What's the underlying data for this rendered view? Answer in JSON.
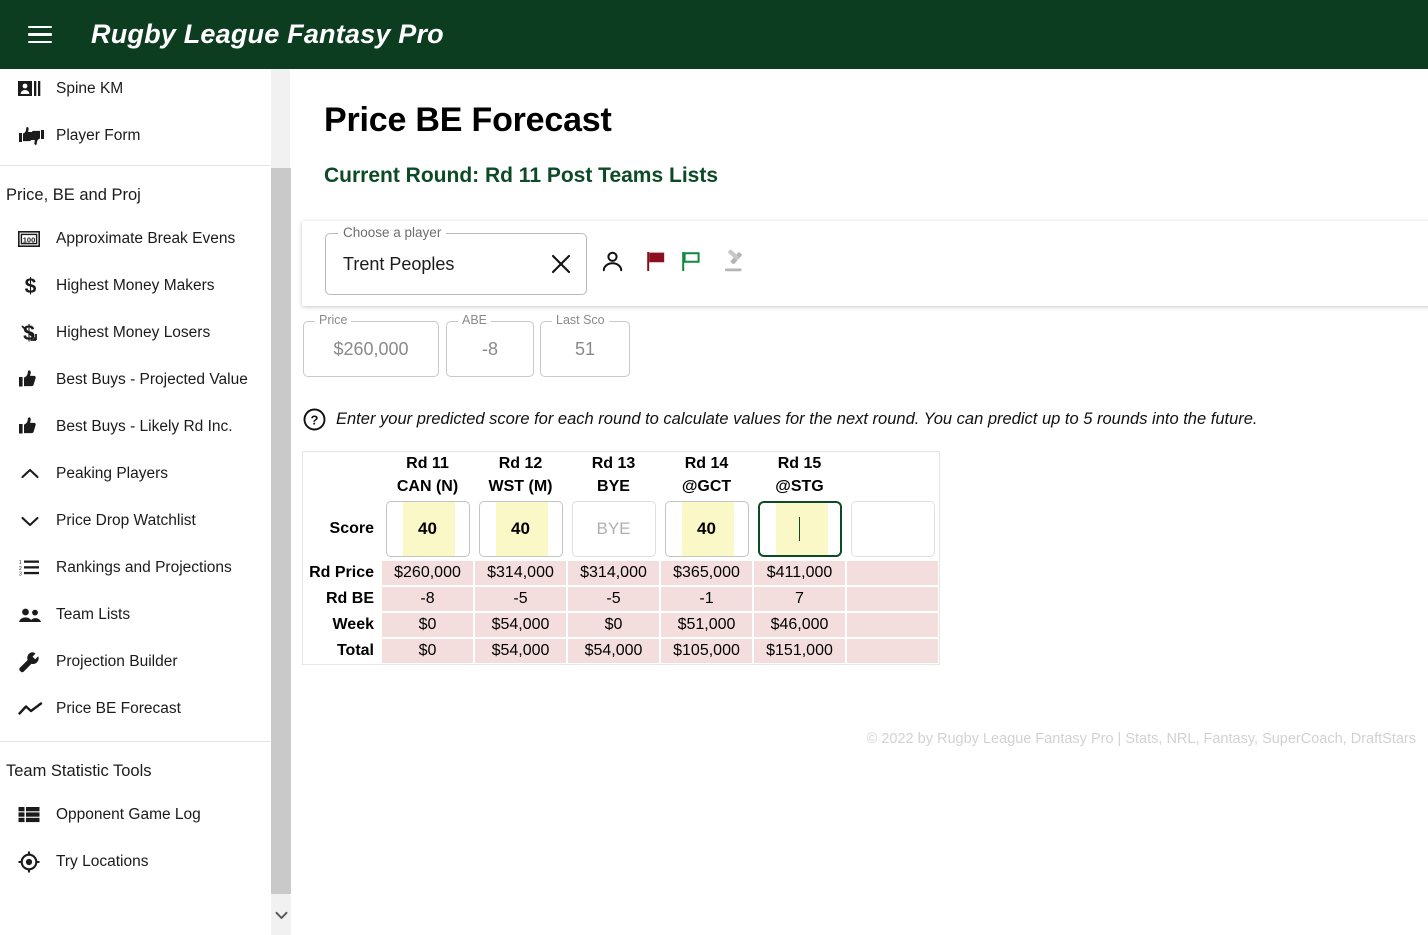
{
  "header": {
    "title": "Rugby League Fantasy Pro",
    "menu_icon": "hamburger-menu-icon",
    "background_color": "#0d3d21"
  },
  "sidebar": {
    "top_items": [
      {
        "label": "Spine KM",
        "icon": "spine-km-icon"
      },
      {
        "label": "Player Form",
        "icon": "thumbs-up-down-icon"
      }
    ],
    "sections": [
      {
        "title": "Price, BE and Proj",
        "items": [
          {
            "label": "Approximate Break Evens",
            "icon": "money-100-icon"
          },
          {
            "label": "Highest Money Makers",
            "icon": "dollar-sign-icon"
          },
          {
            "label": "Highest Money Losers",
            "icon": "dollar-down-icon"
          },
          {
            "label": "Best Buys - Projected Value",
            "icon": "thumbs-up-icon"
          },
          {
            "label": "Best Buys - Likely Rd Inc.",
            "icon": "thumbs-up-icon"
          },
          {
            "label": "Peaking Players",
            "icon": "chevron-up-icon"
          },
          {
            "label": "Price Drop Watchlist",
            "icon": "chevron-down-icon"
          },
          {
            "label": "Rankings and Projections",
            "icon": "numbered-list-icon"
          },
          {
            "label": "Team Lists",
            "icon": "people-icon"
          },
          {
            "label": "Projection Builder",
            "icon": "wrench-icon"
          },
          {
            "label": "Price BE Forecast",
            "icon": "trend-line-icon"
          }
        ]
      },
      {
        "title": "Team Statistic Tools",
        "items": [
          {
            "label": "Opponent Game Log",
            "icon": "table-list-icon"
          },
          {
            "label": "Try Locations",
            "icon": "target-icon"
          }
        ]
      }
    ],
    "scrollbar": {
      "down_arrow_icon": "chevron-down-icon"
    }
  },
  "main": {
    "page_title": "Price BE Forecast",
    "current_round": "Current Round: Rd 11 Post Teams Lists",
    "current_round_color": "#0d4a26",
    "player_selector": {
      "legend": "Choose a player",
      "value": "Trent Peoples",
      "clear_icon": "close-x-icon"
    },
    "tool_icons": [
      {
        "name": "player-profile-icon",
        "color": "#111111"
      },
      {
        "name": "red-flag-icon",
        "color": "#8b0f1e"
      },
      {
        "name": "green-flag-icon",
        "color": "#0f8a3c"
      },
      {
        "name": "gavel-icon",
        "color": "#b0b0b0"
      }
    ],
    "stats": [
      {
        "legend": "Price",
        "value": "$260,000"
      },
      {
        "legend": "ABE",
        "value": "-8"
      },
      {
        "legend": "Last Sco",
        "value": "51"
      }
    ],
    "hint": {
      "icon": "help-circle-icon",
      "text": "Enter your predicted score for each round to calculate values for the next round. You can predict up to 5 rounds into the future."
    },
    "footer": "© 2022 by Rugby League Fantasy Pro | Stats, NRL, Fantasy, SuperCoach, DraftStars"
  },
  "chart_data": {
    "type": "table",
    "title": "Price BE Forecast",
    "columns": [
      {
        "round": "Rd 11",
        "opponent": "CAN (N)"
      },
      {
        "round": "Rd 12",
        "opponent": "WST (M)"
      },
      {
        "round": "Rd 13",
        "opponent": "BYE"
      },
      {
        "round": "Rd 14",
        "opponent": "@GCT"
      },
      {
        "round": "Rd 15",
        "opponent": "@STG"
      }
    ],
    "row_labels": [
      "Score",
      "Rd Price",
      "Rd BE",
      "Week",
      "Total"
    ],
    "score_inputs": [
      {
        "value": "40",
        "state": "filled"
      },
      {
        "value": "40",
        "state": "filled"
      },
      {
        "value": "BYE",
        "state": "bye"
      },
      {
        "value": "40",
        "state": "filled"
      },
      {
        "value": "",
        "state": "focused"
      },
      {
        "value": "",
        "state": "plain"
      }
    ],
    "rows": [
      {
        "label": "Rd Price",
        "values": [
          "$260,000",
          "$314,000",
          "$314,000",
          "$365,000",
          "$411,000",
          ""
        ]
      },
      {
        "label": "Rd BE",
        "values": [
          "-8",
          "-5",
          "-5",
          "-1",
          "7",
          ""
        ]
      },
      {
        "label": "Week",
        "values": [
          "$0",
          "$54,000",
          "$0",
          "$51,000",
          "$46,000",
          ""
        ]
      },
      {
        "label": "Total",
        "values": [
          "$0",
          "$54,000",
          "$54,000",
          "$105,000",
          "$151,000",
          ""
        ]
      }
    ],
    "cell_background": "#f3dedd",
    "input_fill": "#fbf8c8"
  }
}
